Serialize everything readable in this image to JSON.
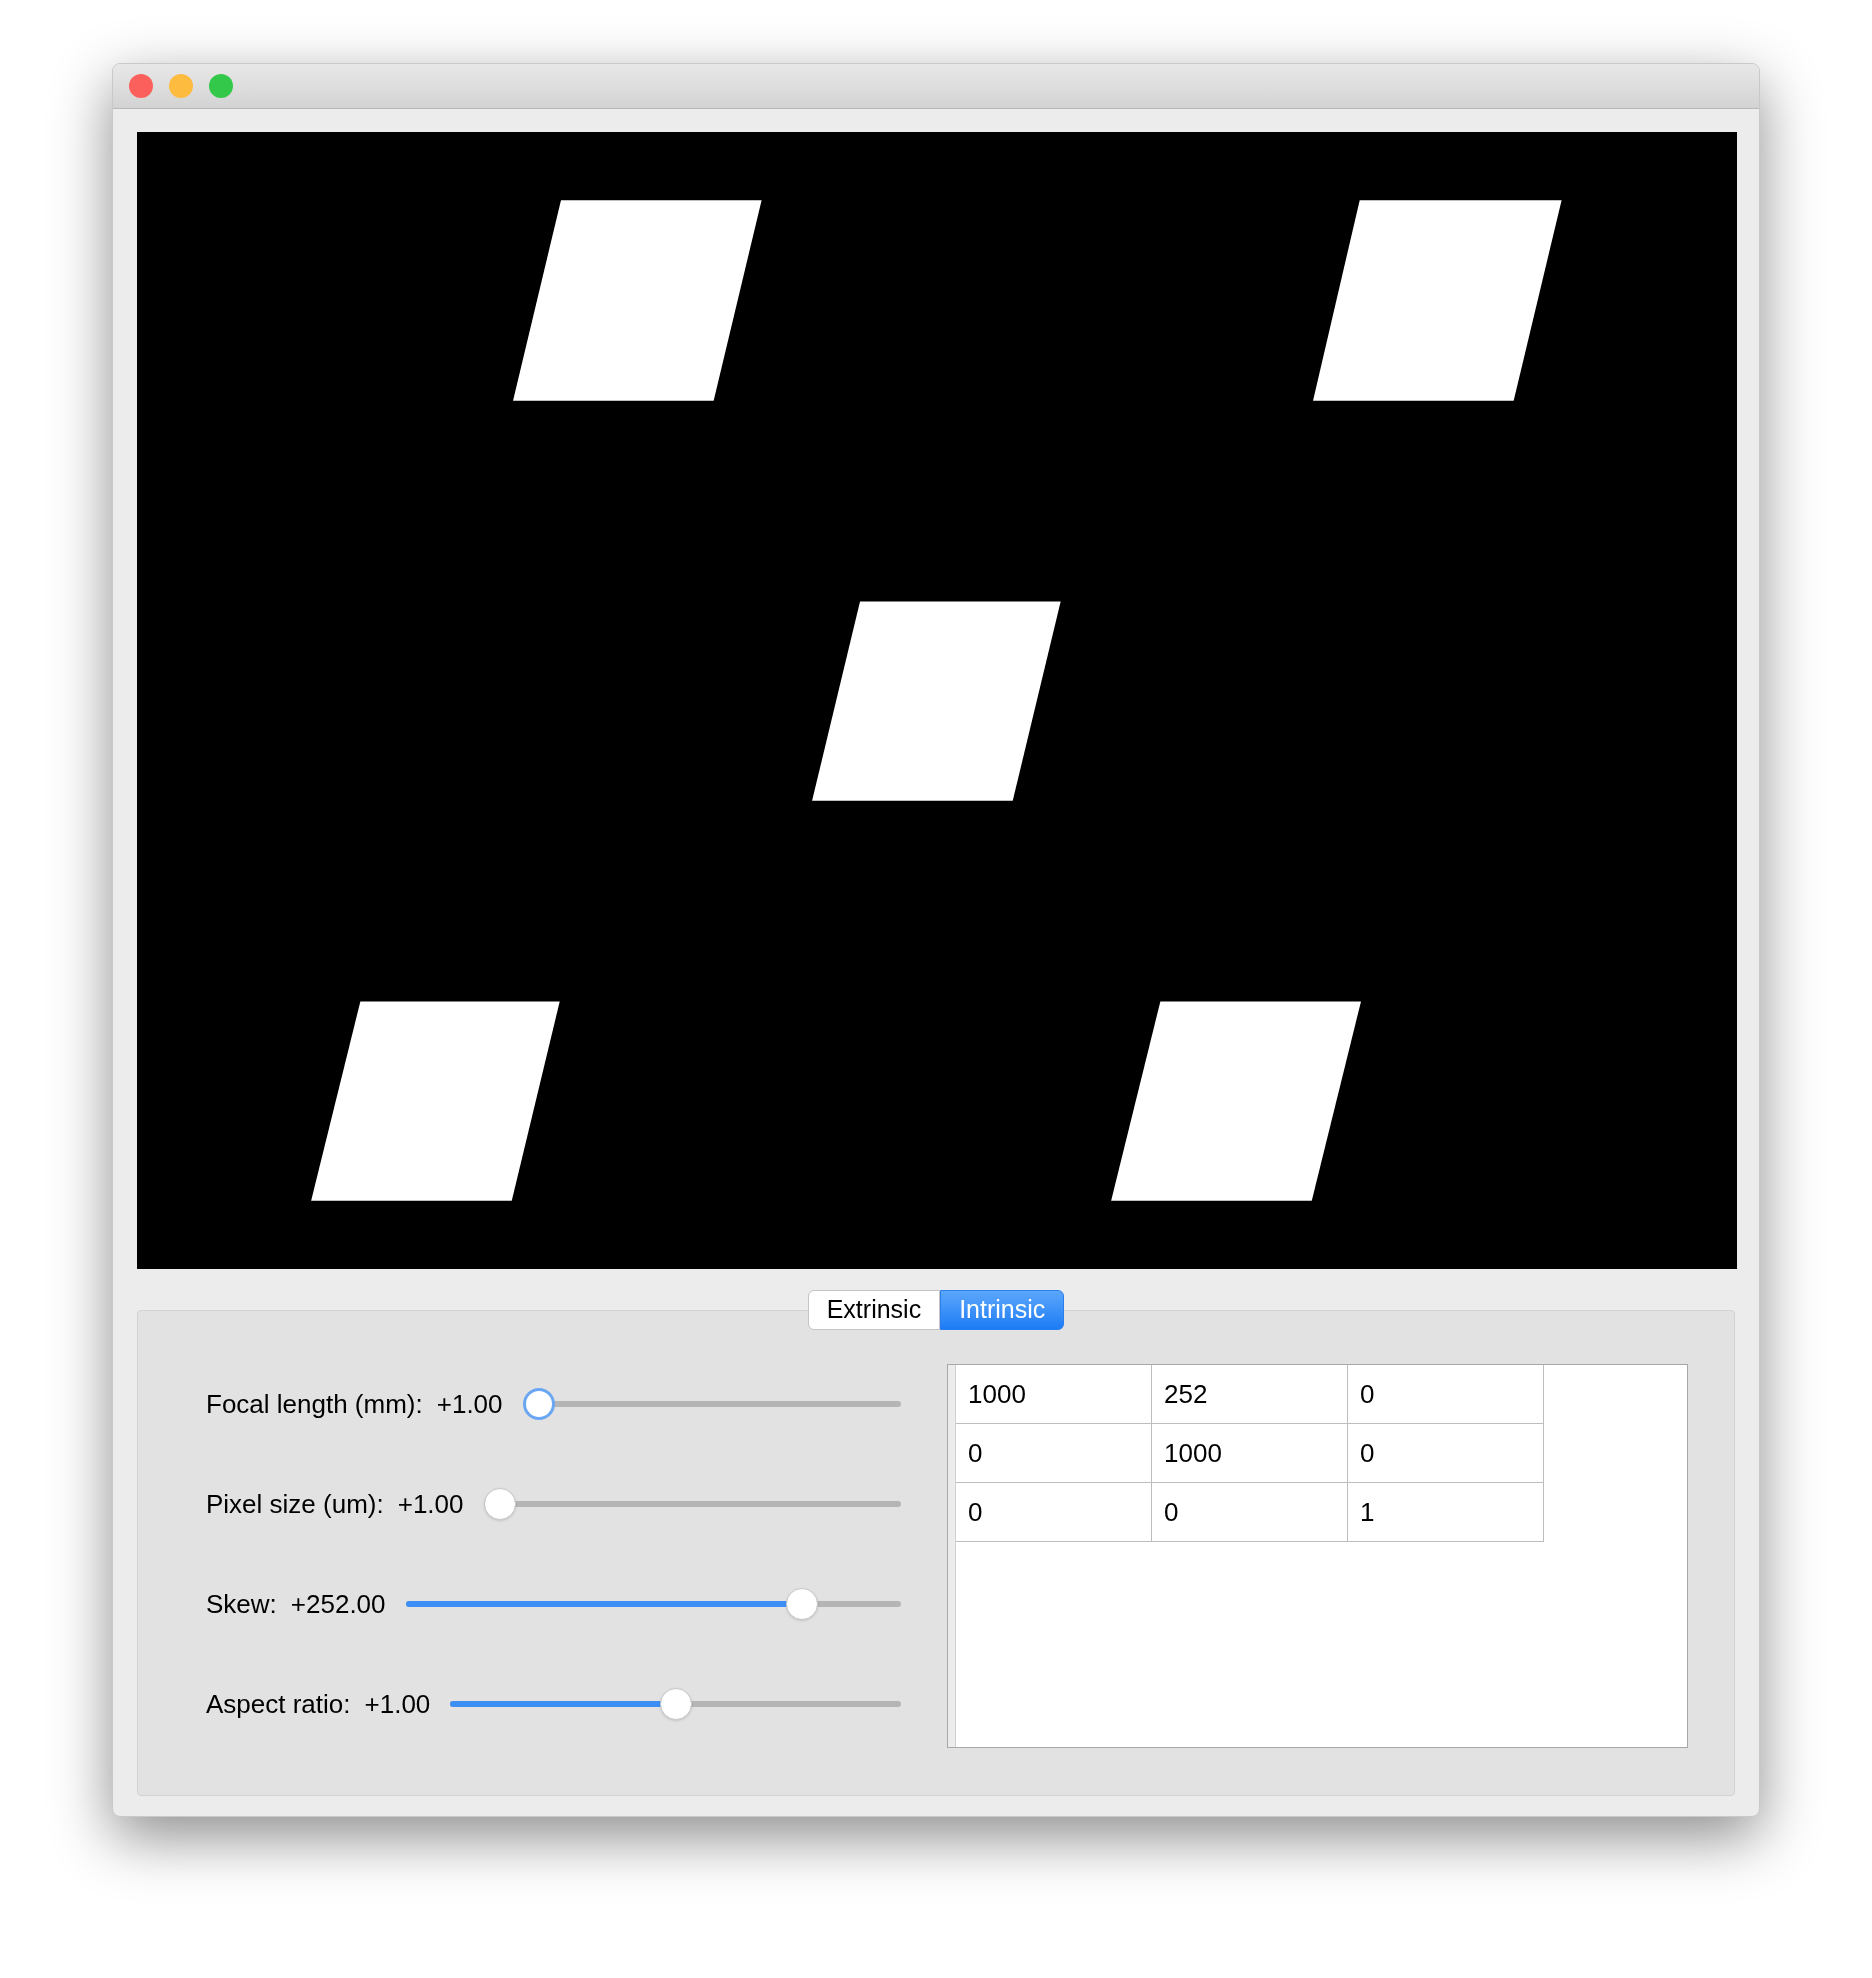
{
  "window": {
    "buttons": [
      {
        "color": "#fc605c"
      },
      {
        "color": "#fdbc40"
      },
      {
        "color": "#34c84a"
      }
    ]
  },
  "tabs": [
    {
      "label": "Extrinsic",
      "selected": false
    },
    {
      "label": "Intrinsic",
      "selected": true
    }
  ],
  "sliders": [
    {
      "label": "Focal length (mm):",
      "reading": "+1.00",
      "level": 0,
      "focused": true
    },
    {
      "label": "Pixel size (um):",
      "reading": "+1.00",
      "level": 0,
      "focused": false
    },
    {
      "label": "Skew:",
      "reading": "+252.00",
      "level": 0.82,
      "focused": false
    },
    {
      "label": "Aspect ratio:",
      "reading": "+1.00",
      "level": 0.5,
      "focused": false
    }
  ],
  "matrix": {
    "rows": [
      [
        "1000",
        "252",
        "0"
      ],
      [
        "0",
        "1000",
        "0"
      ],
      [
        "0",
        "0",
        "1"
      ]
    ]
  }
}
